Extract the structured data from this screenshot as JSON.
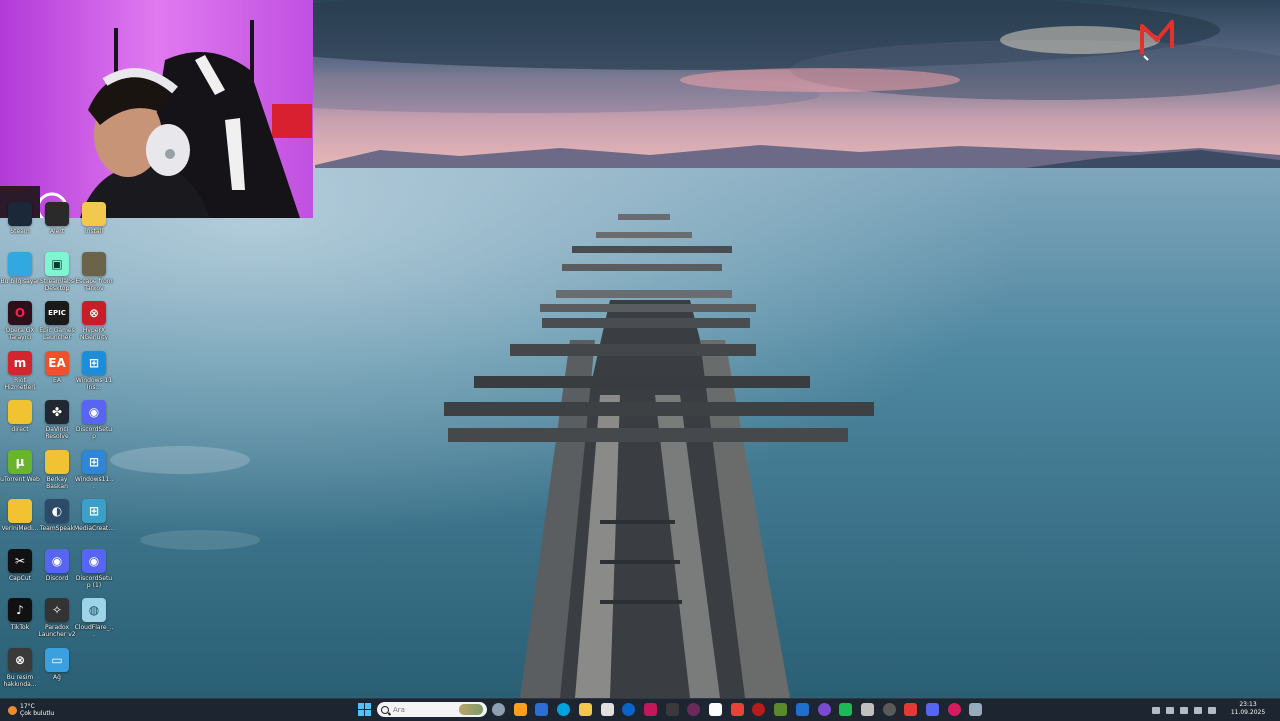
{
  "desktop": {
    "icons": [
      {
        "label": "Steam",
        "glyph": "",
        "bg": "#1b2838",
        "fg": "#ffffff"
      },
      {
        "label": "Alert",
        "glyph": "",
        "bg": "#2a2a2a",
        "fg": "#ffffff"
      },
      {
        "label": "Install",
        "glyph": "",
        "bg": "#f2c94c",
        "fg": "#222222"
      },
      {
        "label": "Bu bilgisayar",
        "glyph": "",
        "bg": "#31a8e0",
        "fg": "#ffffff"
      },
      {
        "label": "Streamlabs Desktop",
        "glyph": "▣",
        "bg": "#80f5d2",
        "fg": "#0a3a30"
      },
      {
        "label": "Escape from Tarkov",
        "glyph": "",
        "bg": "#6b6448",
        "fg": "#ffffff"
      },
      {
        "label": "Opera GX Tarayıcı",
        "glyph": "O",
        "bg": "#2b0f1a",
        "fg": "#fa1e4e"
      },
      {
        "label": "Epic Games Launcher",
        "glyph": "EPIC",
        "bg": "#1a1a1a",
        "fg": "#ffffff"
      },
      {
        "label": "HyperX NGenuity",
        "glyph": "⊗",
        "bg": "#c81e28",
        "fg": "#ffffff"
      },
      {
        "label": "Riot Hizmetleri",
        "glyph": "m",
        "bg": "#d5252c",
        "fg": "#ffffff"
      },
      {
        "label": "EA",
        "glyph": "EA",
        "bg": "#f0502a",
        "fg": "#ffffff"
      },
      {
        "label": "Windows 11 Ins...",
        "glyph": "⊞",
        "bg": "#1c8ed9",
        "fg": "#ffffff"
      },
      {
        "label": "direct",
        "glyph": "",
        "bg": "#f1c232",
        "fg": "#222222"
      },
      {
        "label": "DaVinci Resolve",
        "glyph": "✤",
        "bg": "#222831",
        "fg": "#ffffff"
      },
      {
        "label": "DiscordSetup",
        "glyph": "◉",
        "bg": "#5865f2",
        "fg": "#ffffff"
      },
      {
        "label": "uTorrent Web",
        "glyph": "µ",
        "bg": "#6ab42d",
        "fg": "#ffffff"
      },
      {
        "label": "Berkay Baskan",
        "glyph": "",
        "bg": "#f1c232",
        "fg": "#222222"
      },
      {
        "label": "Windows11...",
        "glyph": "⊞",
        "bg": "#2f86d6",
        "fg": "#ffffff"
      },
      {
        "label": "VeriniMedi...",
        "glyph": "",
        "bg": "#f1c232",
        "fg": "#222222"
      },
      {
        "label": "TeamSpeak",
        "glyph": "◐",
        "bg": "#2d4a68",
        "fg": "#ffffff"
      },
      {
        "label": "MediaCreat...",
        "glyph": "⊞",
        "bg": "#3aa0c8",
        "fg": "#ffffff"
      },
      {
        "label": "CapCut",
        "glyph": "✂",
        "bg": "#111111",
        "fg": "#ffffff"
      },
      {
        "label": "Discord",
        "glyph": "◉",
        "bg": "#5865f2",
        "fg": "#ffffff"
      },
      {
        "label": "DiscordSetup (1)",
        "glyph": "◉",
        "bg": "#5865f2",
        "fg": "#ffffff"
      },
      {
        "label": "TikTok",
        "glyph": "♪",
        "bg": "#111111",
        "fg": "#ffffff"
      },
      {
        "label": "Paradox Launcher v2",
        "glyph": "✧",
        "bg": "#333333",
        "fg": "#ffffff"
      },
      {
        "label": "CloudFlare_...",
        "glyph": "◍",
        "bg": "#9fd3e8",
        "fg": "#1a4a66"
      },
      {
        "label": "Bu resim hakkında...",
        "glyph": "⊗",
        "bg": "#3a3a3a",
        "fg": "#ffffff"
      },
      {
        "label": "Ağ",
        "glyph": "▭",
        "bg": "#3aa0e0",
        "fg": "#ffffff"
      }
    ]
  },
  "taskbar": {
    "weather_temp": "17°C",
    "weather_desc": "Çok bulutlu",
    "search_placeholder": "Ara",
    "pinned_colors": [
      "#8ea0b0",
      "#ff9f1a",
      "#2b6fd6",
      "#00a3e0",
      "#f2c94c",
      "#e0e0e0",
      "#0a64c8",
      "#c2185b",
      "#3a3a3a",
      "#6a2a5a",
      "#ffffff",
      "#ea4335",
      "#b71c1c",
      "#5a8a2a",
      "#1f6fcf",
      "#7a4ad0",
      "#1db954",
      "#c0c0c0",
      "#5a5a5a",
      "#e53935",
      "#5865f2",
      "#d81b60",
      "#9ab"
    ],
    "time": "23:13",
    "date": "11.09.2025"
  }
}
